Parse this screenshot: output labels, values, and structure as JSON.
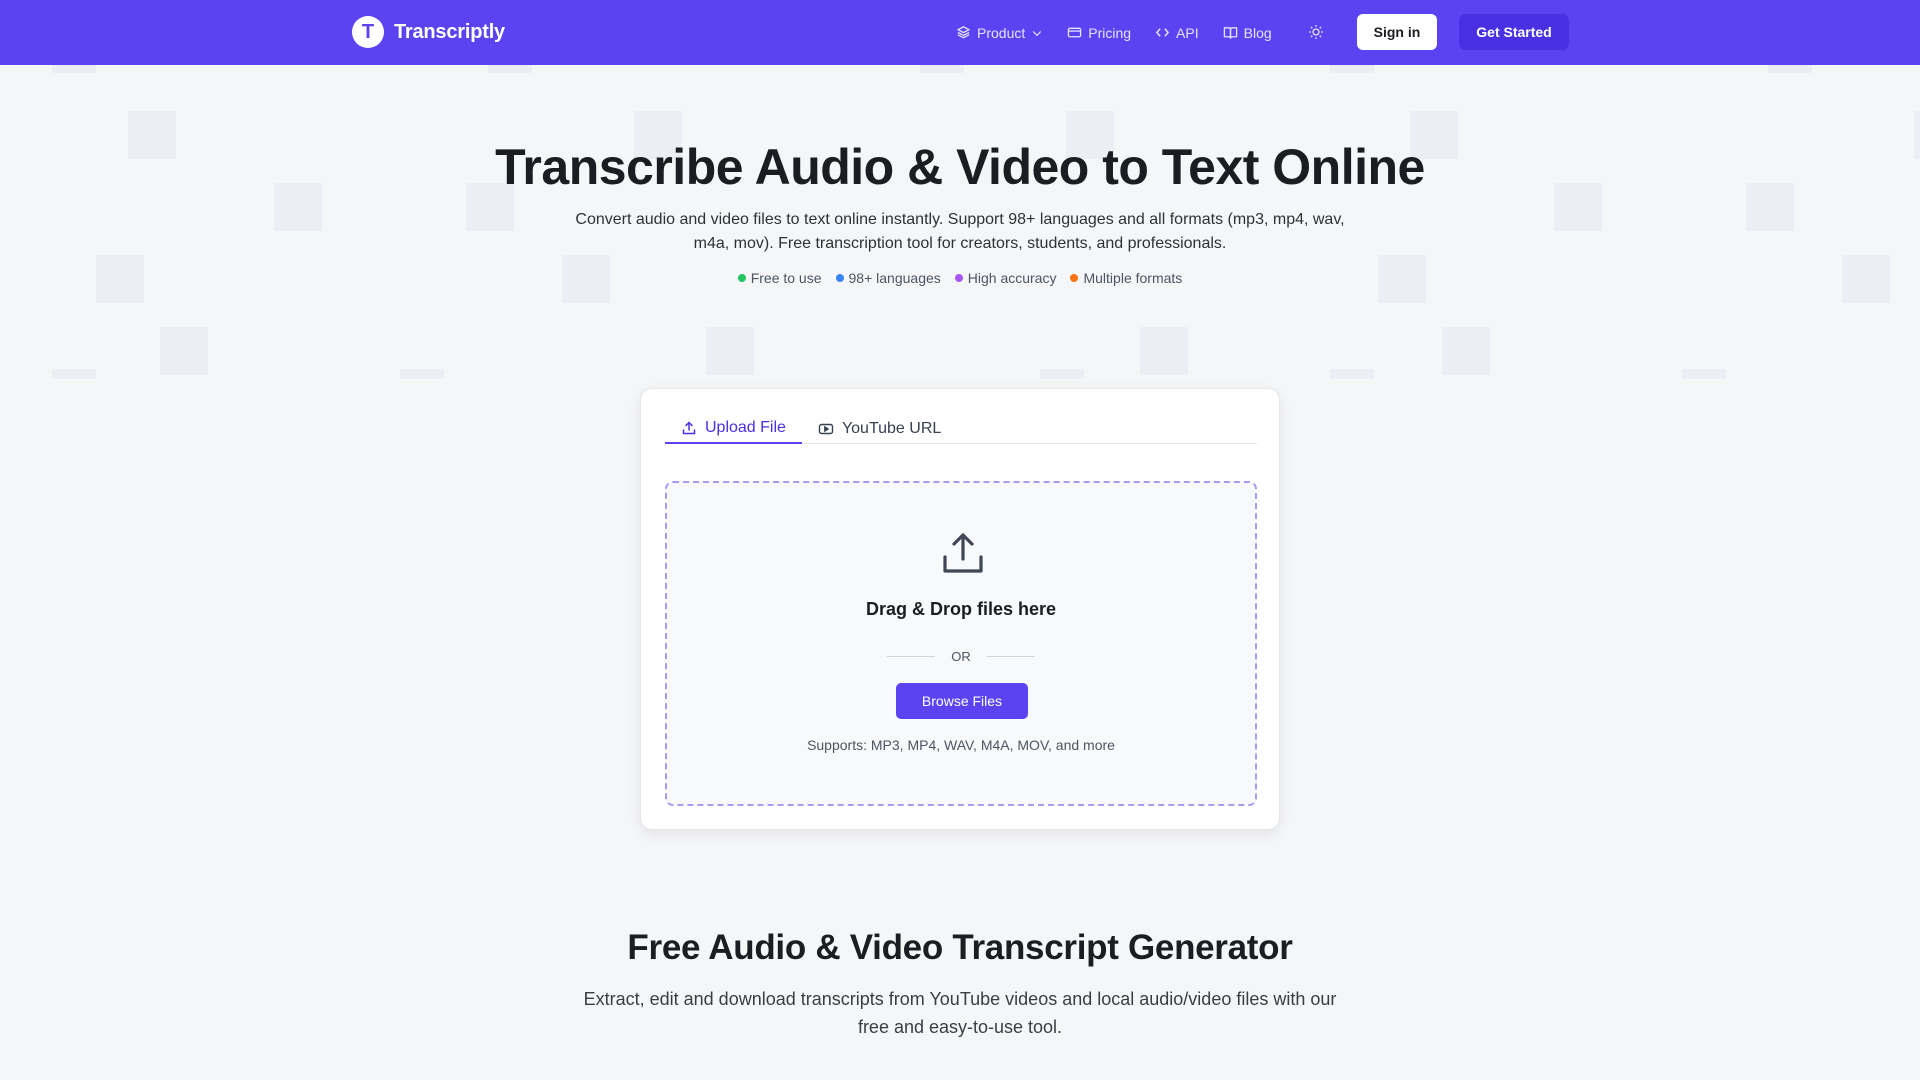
{
  "nav": {
    "brand_initial": "T",
    "brand_name": "Transcriptly",
    "links": [
      {
        "label": "Product",
        "icon": "layers-icon"
      },
      {
        "label": "Pricing",
        "icon": "card-icon"
      },
      {
        "label": "API",
        "icon": "code-icon"
      },
      {
        "label": "Blog",
        "icon": "book-icon"
      }
    ],
    "theme_icon": "sun-icon",
    "signin_label": "Sign in",
    "get_started_label": "Get Started"
  },
  "hero": {
    "title": "Transcribe Audio & Video to Text Online",
    "subtitle": "Convert audio and video files to text online instantly. Support 98+ languages and all formats (mp3, mp4, wav, m4a, mov). Free transcription tool for creators, students, and professionals.",
    "features": [
      {
        "label": "Free to use",
        "color": "#22c55e"
      },
      {
        "label": "98+ languages",
        "color": "#3b82f6"
      },
      {
        "label": "High accuracy",
        "color": "#a855f7"
      },
      {
        "label": "Multiple formats",
        "color": "#f97316"
      }
    ]
  },
  "upload": {
    "tabs": [
      {
        "label": "Upload File",
        "icon": "upload-icon",
        "active": true
      },
      {
        "label": "YouTube URL",
        "icon": "youtube-icon",
        "active": false
      }
    ],
    "drop_title": "Drag & Drop files here",
    "or_text": "OR",
    "browse_label": "Browse Files",
    "supports_text": "Supports: MP3, MP4, WAV, M4A, MOV, and more"
  },
  "section": {
    "title": "Free Audio & Video Transcript Generator",
    "subtitle": "Extract, edit and download transcripts from YouTube videos and local audio/video files with our free and easy-to-use tool."
  },
  "colors": {
    "brand": "#5b43f1",
    "accent_dark": "#4a30e3"
  }
}
